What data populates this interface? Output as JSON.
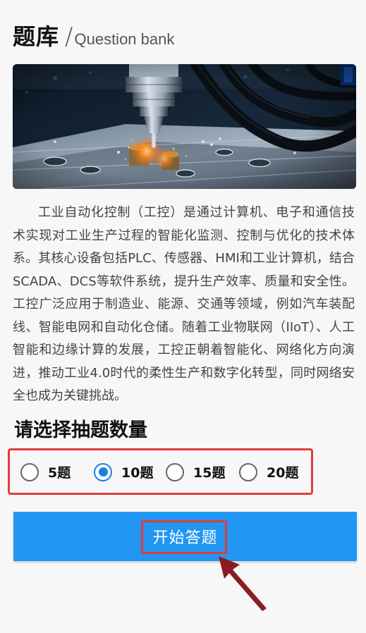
{
  "header": {
    "title": "题库",
    "separator": "/",
    "subtitle": "Question bank"
  },
  "hero": {
    "image": "industrial-cnc-machine-photo"
  },
  "intro": {
    "text": "工业自动化控制（工控）是通过计算机、电子和通信技术实现对工业生产过程的智能化监测、控制与优化的技术体系。其核心设备包括PLC、传感器、HMI和工业计算机，结合SCADA、DCS等软件系统，提升生产效率、质量和安全性。工控广泛应用于制造业、能源、交通等领域，例如汽车装配线、智能电网和自动化仓储。随着工业物联网（IIoT）、人工智能和边缘计算的发展，工控正朝着智能化、网络化方向演进，推动工业4.0时代的柔性生产和数字化转型，同时网络安全也成为关键挑战。"
  },
  "quantity": {
    "title": "请选择抽题数量",
    "selected_value": "10题",
    "options": [
      {
        "label": "5题",
        "checked": false
      },
      {
        "label": "10题",
        "checked": true
      },
      {
        "label": "15题",
        "checked": false
      },
      {
        "label": "20题",
        "checked": false
      }
    ]
  },
  "start_button": {
    "label": "开始答题"
  },
  "colors": {
    "primary": "#2196f3",
    "radio_checked": "#1e7fe0",
    "highlight": "#e33a3a",
    "arrow": "#8b1d22",
    "background": "#f7f7f7"
  }
}
